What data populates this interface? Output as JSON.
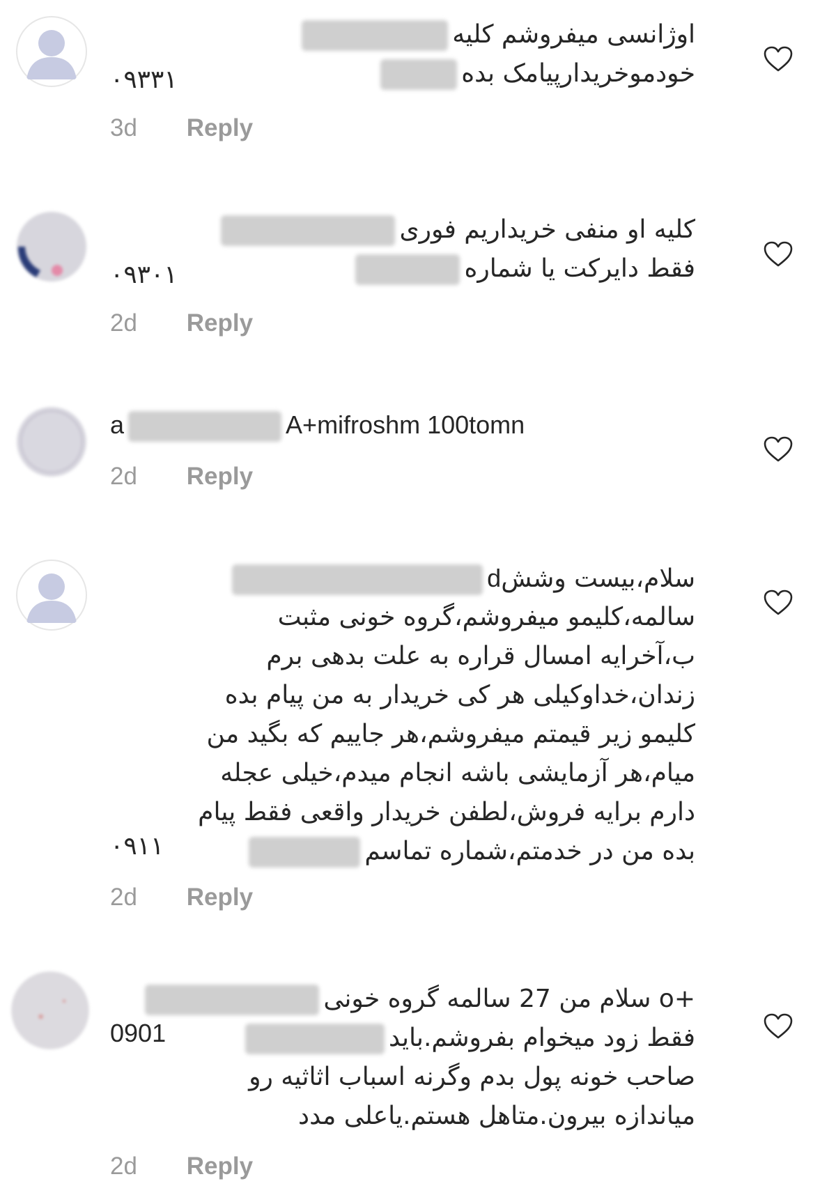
{
  "comments": [
    {
      "lines": [
        {
          "dir": "rtl",
          "text": "اوژانسی میفروشم کلیه"
        },
        {
          "dir": "rtl",
          "text": "خودموخریدارپیامک بده"
        },
        {
          "dir": "ltr",
          "prefix": "۰۹۳۳۱"
        }
      ],
      "time": "3d",
      "reply": "Reply"
    },
    {
      "lines": [
        {
          "dir": "rtl",
          "text": "کلیه او منفی خریداریم فوری"
        },
        {
          "dir": "rtl",
          "text": "فقط دایرکت یا شماره"
        },
        {
          "dir": "ltr",
          "prefix": "۰۹۳۰۱"
        }
      ],
      "time": "2d",
      "reply": "Reply"
    },
    {
      "lines": [
        {
          "dir": "ltr",
          "prefix": "a",
          "text": "A+mifroshm 100tomn"
        }
      ],
      "time": "2d",
      "reply": "Reply"
    },
    {
      "lines": [
        {
          "dir": "rtl",
          "text": "سلام،بیست وشش"
        },
        {
          "dir": "rtl",
          "text": "سالمه،کلیمو میفروشم،گروه خونی مثبت"
        },
        {
          "dir": "rtl",
          "text": "ب،آخرایه امسال قراره به علت بدهی برم"
        },
        {
          "dir": "rtl",
          "text": "زندان،خداوکیلی هر کی خریدار به من پیام بده"
        },
        {
          "dir": "rtl",
          "text": "کلیمو زیر قیمتم میفروشم،هر جاییم که بگید من"
        },
        {
          "dir": "rtl",
          "text": "میام،هر آزمایشی باشه انجام میدم،خیلی عجله"
        },
        {
          "dir": "rtl",
          "text": "دارم برایه فروش،لطفن خریدار واقعی فقط پیام"
        },
        {
          "dir": "rtl",
          "text": "بده من در خدمتم،شماره تماسم"
        },
        {
          "dir": "ltr",
          "prefix": "۰۹۱۱"
        }
      ],
      "time": "2d",
      "reply": "Reply"
    },
    {
      "lines": [
        {
          "dir": "rtl",
          "text": "+o سلام من 27 سالمه گروه خونی"
        },
        {
          "dir": "rtl",
          "text": "فقط زود میخوام بفروشم.باید"
        },
        {
          "dir": "ltr",
          "prefix": "0901"
        },
        {
          "dir": "rtl",
          "text": "صاحب خونه پول بدم وگرنه اسباب اثاثیه رو"
        },
        {
          "dir": "rtl",
          "text": "میاندازه بیرون.متاهل هستم.یاعلی مدد"
        }
      ],
      "time": "2d",
      "reply": "Reply"
    }
  ],
  "icons": {
    "like": "heart-outline-icon",
    "avatar": "default-user-avatar-icon"
  },
  "colors": {
    "meta_text": "#9a9a9a",
    "body_text": "#262626",
    "avatar_bg": "#c7cbe2",
    "redaction": "#cfcfcf"
  }
}
